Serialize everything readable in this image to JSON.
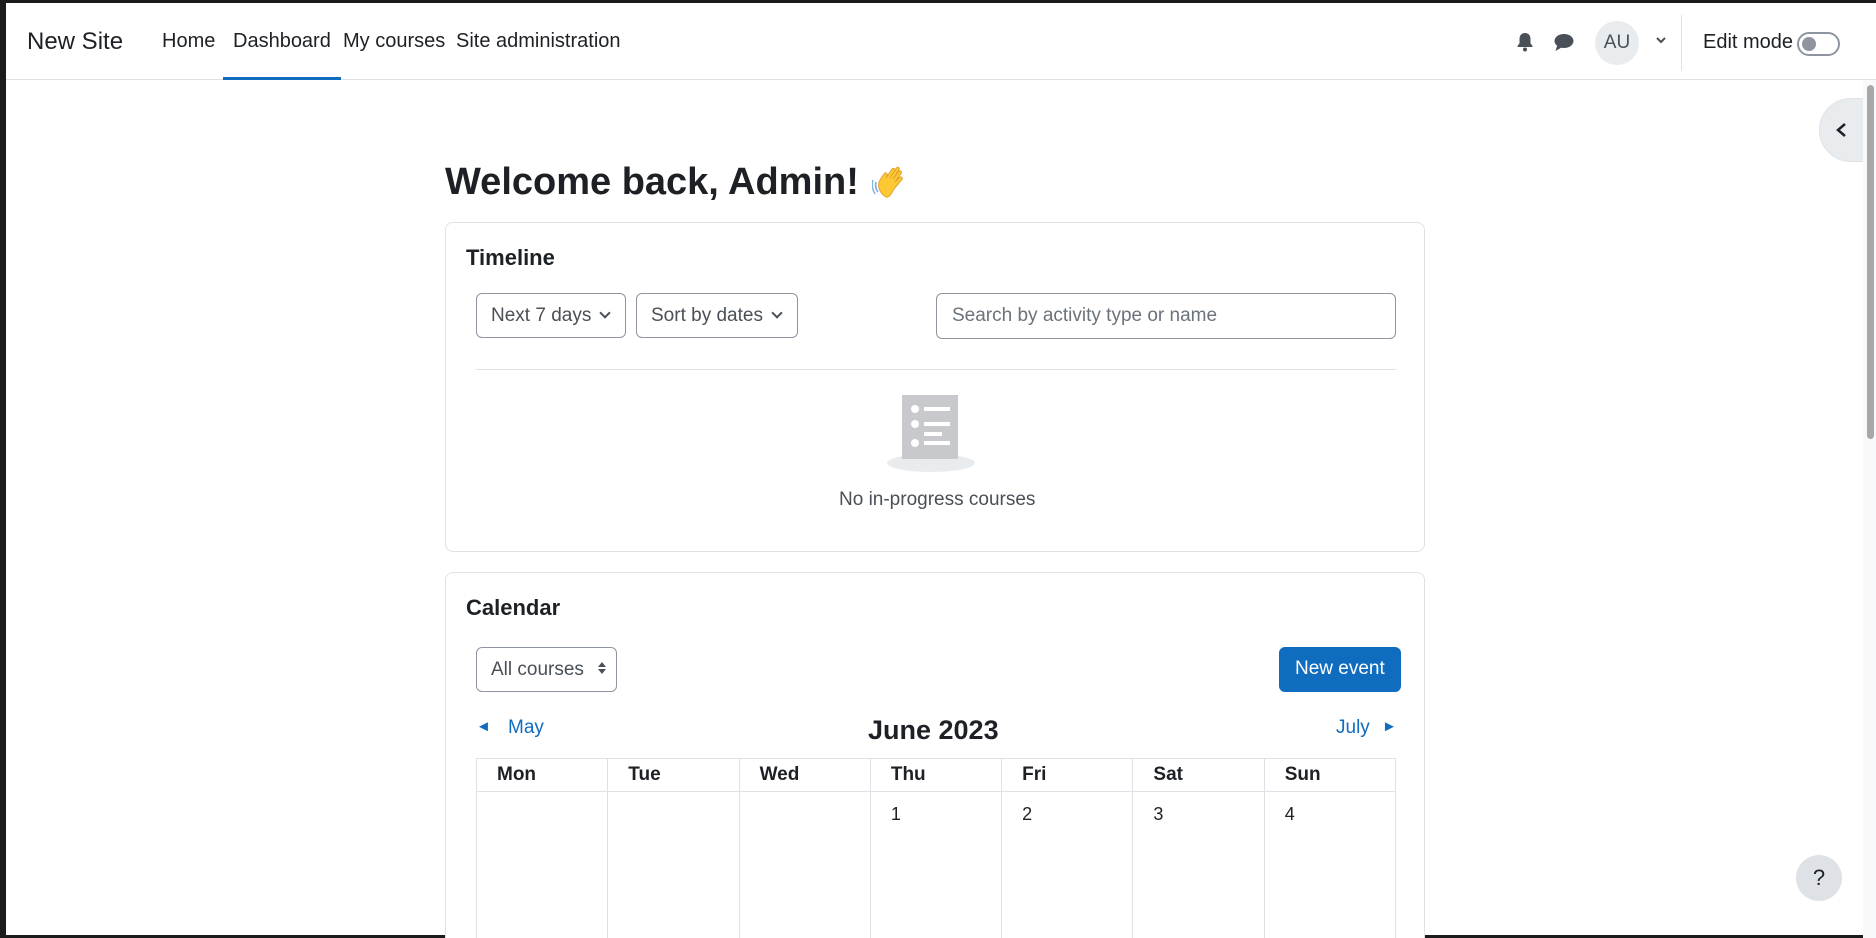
{
  "navbar": {
    "brand": "New Site",
    "links": [
      "Home",
      "Dashboard",
      "My courses",
      "Site administration"
    ],
    "active": "Dashboard",
    "avatar_initials": "AU",
    "edit_mode_label": "Edit mode"
  },
  "page": {
    "title": "Welcome back, Admin!"
  },
  "timeline": {
    "title": "Timeline",
    "filter_label": "Next 7 days",
    "sort_label": "Sort by dates",
    "search_placeholder": "Search by activity type or name",
    "empty_message": "No in-progress courses"
  },
  "calendar": {
    "title": "Calendar",
    "course_filter": "All courses",
    "new_event_label": "New event",
    "prev_month": "May",
    "next_month": "July",
    "prev_arrow": "◄",
    "next_arrow": "►",
    "month_title": "June 2023",
    "weekdays": [
      "Mon",
      "Tue",
      "Wed",
      "Thu",
      "Fri",
      "Sat",
      "Sun"
    ],
    "first_week": [
      "",
      "",
      "",
      "1",
      "2",
      "3",
      "4"
    ]
  },
  "help": {
    "label": "?"
  },
  "colors": {
    "accent": "#0f6cbf",
    "text": "#1d2125",
    "border": "#dee2e6"
  }
}
